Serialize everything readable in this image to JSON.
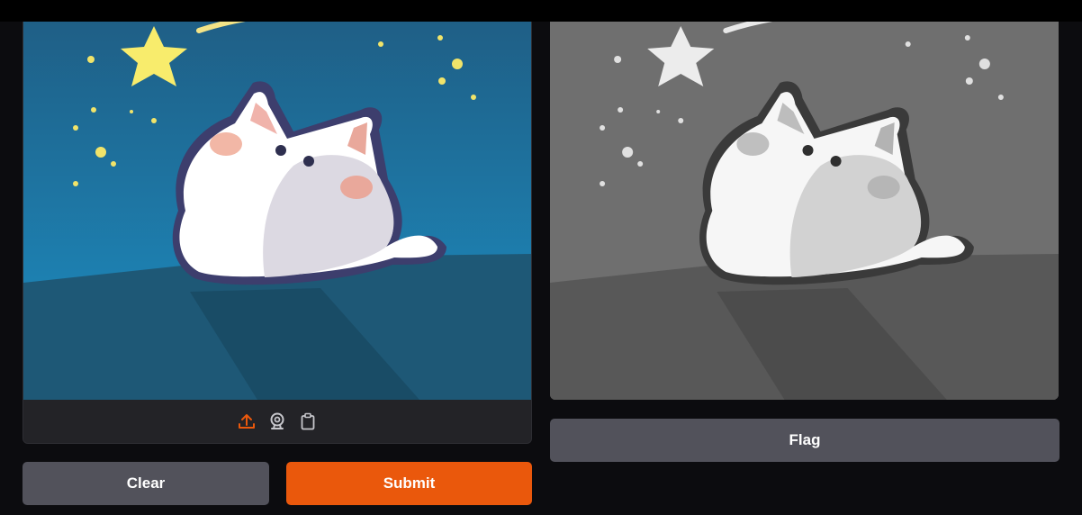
{
  "input": {
    "toolbar": {
      "upload_icon": "upload-icon",
      "webcam_icon": "webcam-icon",
      "clipboard_icon": "clipboard-icon",
      "active_color": "#ea580c",
      "icon_color": "#c7c7cc"
    }
  },
  "buttons": {
    "clear_label": "Clear",
    "submit_label": "Submit",
    "flag_label": "Flag"
  },
  "colors": {
    "background": "#0c0c0f",
    "secondary_button": "#52525b",
    "primary_button": "#ea580c"
  }
}
